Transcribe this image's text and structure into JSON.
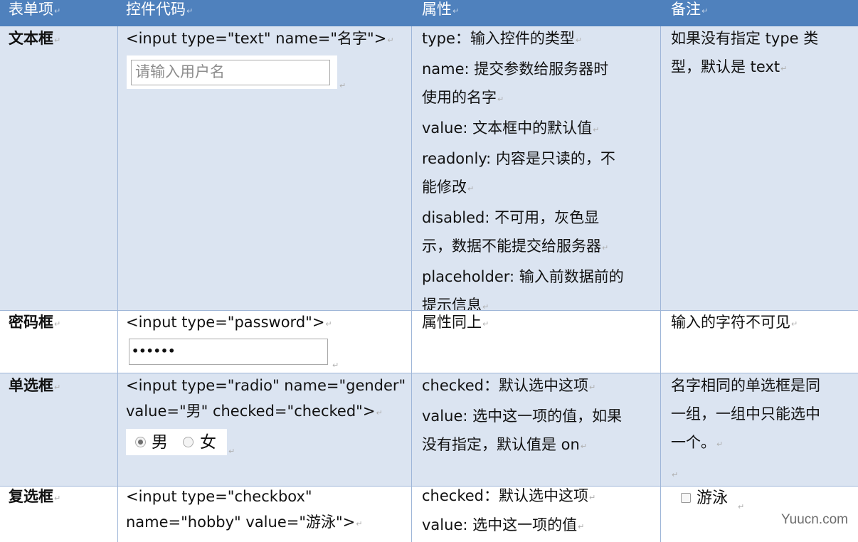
{
  "headers": [
    "表单项",
    "控件代码",
    "属性",
    "备注"
  ],
  "return_mark": "↵",
  "rows": [
    {
      "item": "文本框",
      "code": [
        "<input type=\"text\" name=\"名字\">"
      ],
      "demo_placeholder": "请输入用户名",
      "attributes": [
        "type：输入控件的类型",
        "name: 提交参数给服务器时",
        "使用的名字",
        "value: 文本框中的默认值",
        "readonly: 内容是只读的，不",
        "能修改",
        "disabled: 不可用，灰色显",
        "示，数据不能提交给服务器",
        "placeholder: 输入前数据前的",
        "提示信息"
      ],
      "note": [
        "如果没有指定 type 类",
        "型，默认是 text"
      ]
    },
    {
      "item": "密码框",
      "code": [
        "<input type=\"password\">"
      ],
      "demo_value": "••••••",
      "attributes": [
        "属性同上"
      ],
      "note": [
        "输入的字符不可见"
      ]
    },
    {
      "item": "单选框",
      "code": [
        "<input type=\"radio\" name=\"gender\"",
        "value=\"男\" checked=\"checked\">"
      ],
      "demo_options": [
        "男",
        "女"
      ],
      "attributes": [
        "checked：默认选中这项",
        "value: 选中这一项的值，如果",
        "没有指定，默认值是 on"
      ],
      "note": [
        "名字相同的单选框是同",
        "一组，一组中只能选中",
        "一个。"
      ]
    },
    {
      "item": "复选框",
      "code": [
        "<input type=\"checkbox\"",
        "name=\"hobby\" value=\"游泳\">"
      ],
      "attributes": [
        "checked：默认选中这项",
        "value: 选中这一项的值"
      ],
      "note_checkbox_label": "游泳"
    }
  ],
  "watermark": "Yuucn.com",
  "colors": {
    "header_bg": "#4f81bd",
    "shade_bg": "#dbe4f1",
    "grid": "#9fb6d8"
  }
}
